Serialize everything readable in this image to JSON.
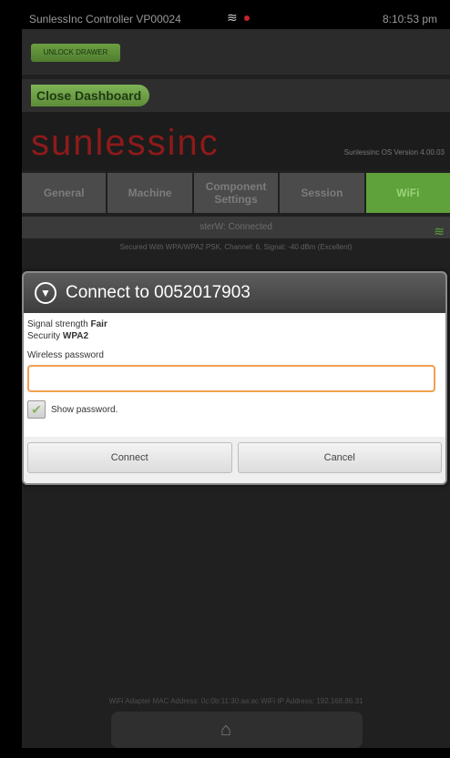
{
  "status_bar": {
    "title": "SunlessInc Controller  VP00024",
    "time": "8:10:53 pm",
    "wifi_icon": "wifi-icon",
    "record_icon": "record-icon"
  },
  "top_bar": {
    "unlock_label": "UNLOCK DRAWER",
    "close_label": "Close Dashboard"
  },
  "brand": {
    "logo_text": "sunlessinc",
    "version": "Sunlessinc OS Version 4.00.03"
  },
  "tabs": [
    {
      "label": "General"
    },
    {
      "label": "Machine"
    },
    {
      "label": "Component Settings"
    },
    {
      "label": "Session"
    },
    {
      "label": "WiFi"
    }
  ],
  "network": {
    "connected": "sterW: Connected",
    "details": "Secured With WPA/WPA2 PSK, Channel: 6, Signal: -40 dBm (Excellent)"
  },
  "footer": {
    "info": "WiFi Adapter MAC Address: 0c:0b:11:30:aa:ac   WiFi IP Address: 192.168.86.31"
  },
  "dialog": {
    "title": "Connect to 0052017903",
    "signal_label": "Signal strength",
    "signal_value": "Fair",
    "security_label": "Security",
    "security_value": "WPA2",
    "password_label": "Wireless password",
    "password_value": "",
    "show_password_label": "Show password.",
    "connect_label": "Connect",
    "cancel_label": "Cancel"
  }
}
